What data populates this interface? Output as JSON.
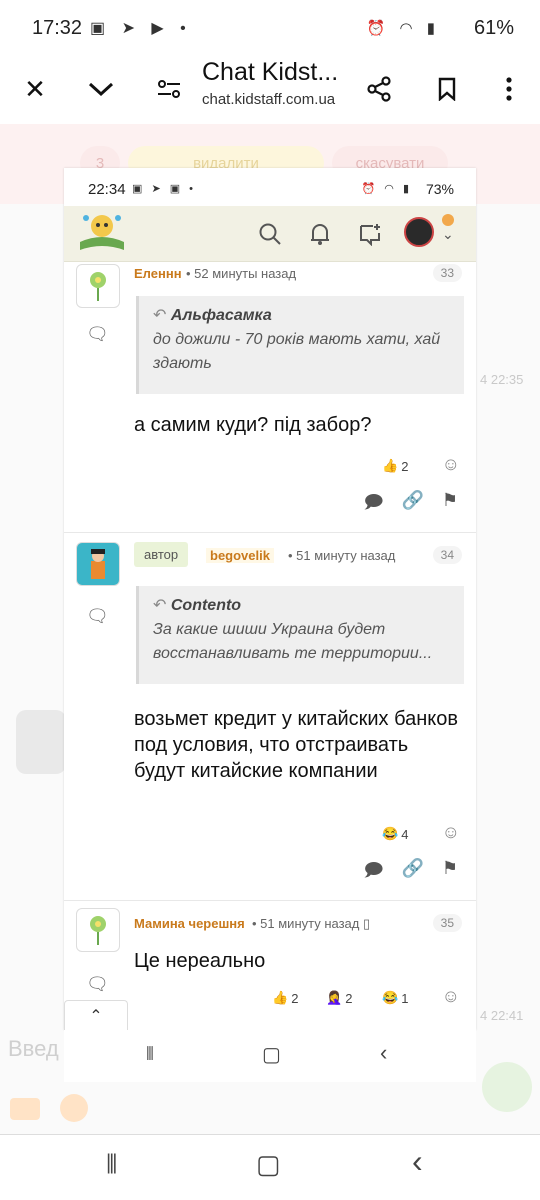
{
  "status_bar": {
    "time": "17:32",
    "battery": "61%"
  },
  "browser": {
    "title": "Chat Kidst...",
    "url": "chat.kidstaff.com.ua"
  },
  "background_page": {
    "pill_count": "3",
    "pill_delete": "видалити",
    "pill_cancel": "скасувати",
    "time1": "4 22:35",
    "time2": "4 22:41",
    "input_placeholder": "Введ"
  },
  "inner_screenshot": {
    "status": {
      "time": "22:34",
      "battery": "73%"
    },
    "comments": [
      {
        "author": "Еленнн",
        "time_ago": "52 минуты назад",
        "number": "33",
        "quote_author": "Альфасамка",
        "quote_text": "до дожили - 70 років мають хати, хай здають",
        "text": "а самим куди? під забор?",
        "reactions": [
          {
            "emoji": "👍",
            "count": "2"
          }
        ]
      },
      {
        "badge": "автор",
        "author": "begovelik",
        "time_ago": "51 минуту назад",
        "number": "34",
        "quote_author": "Contento",
        "quote_text": "За какие шиши Украина будет восстанавливать те территории...",
        "text": "возьмет кредит у китайских банков под условия, что отстраивать будут китайские компании",
        "reactions": [
          {
            "emoji": "😂",
            "count": "4"
          }
        ]
      },
      {
        "author": "Мамина черешня",
        "time_ago": "51 минуту назад",
        "number": "35",
        "text": "Це нереально",
        "reactions": [
          {
            "emoji": "👍",
            "count": "2"
          },
          {
            "emoji": "🤦‍♀️",
            "count": "2"
          },
          {
            "emoji": "😂",
            "count": "1"
          }
        ]
      }
    ]
  },
  "icons": {
    "close": "×",
    "chevron": "⌄",
    "share": "share-icon",
    "bookmark": "bookmark-icon",
    "menu": "⋮"
  }
}
